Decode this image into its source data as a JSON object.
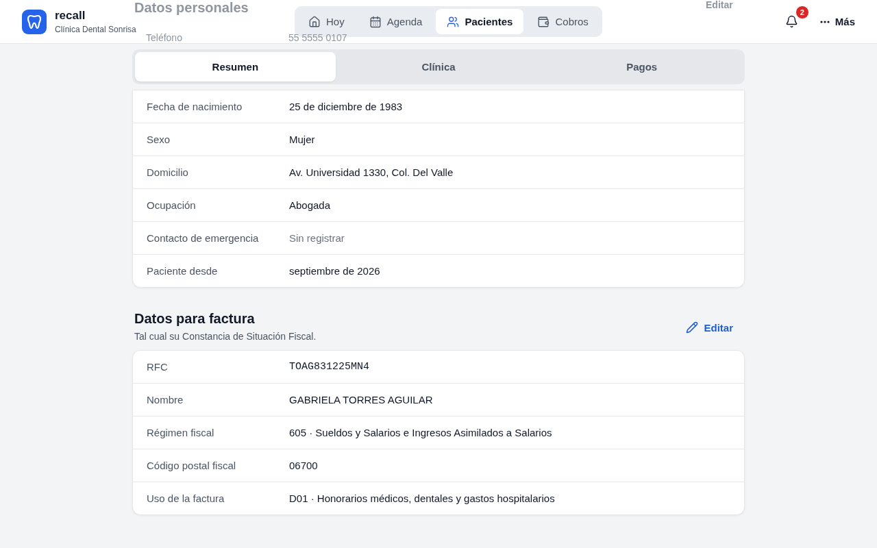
{
  "app": {
    "name": "recall",
    "clinic": "Clínica Dental Sonrisa"
  },
  "nav": [
    {
      "label": "Hoy",
      "selected": false
    },
    {
      "label": "Agenda",
      "selected": false
    },
    {
      "label": "Pacientes",
      "selected": true
    },
    {
      "label": "Cobros",
      "selected": false
    }
  ],
  "notifications": {
    "count": "2"
  },
  "more": {
    "label": "Más"
  },
  "behind_header": {
    "title": "Datos personales",
    "edit": "Editar",
    "label": "Teléfono",
    "value": "55 5555 0107"
  },
  "tabs": [
    {
      "label": "Resumen",
      "selected": true
    },
    {
      "label": "Clínica",
      "selected": false
    },
    {
      "label": "Pagos",
      "selected": false
    }
  ],
  "personal_rows": [
    {
      "label": "Fecha de nacimiento",
      "value": "25 de diciembre de 1983",
      "empty": false
    },
    {
      "label": "Sexo",
      "value": "Mujer",
      "empty": false
    },
    {
      "label": "Domicilio",
      "value": "Av. Universidad 1330, Col. Del Valle",
      "empty": false
    },
    {
      "label": "Ocupación",
      "value": "Abogada",
      "empty": false
    },
    {
      "label": "Contacto de emergencia",
      "value": "Sin registrar",
      "empty": true
    },
    {
      "label": "Paciente desde",
      "value": "septiembre de 2026",
      "empty": false
    }
  ],
  "billing": {
    "title": "Datos para factura",
    "subtitle": "Tal cual su Constancia de Situación Fiscal.",
    "edit": "Editar",
    "rows": [
      {
        "label": "RFC",
        "value": "TOAG831225MN4",
        "kind": "mono"
      },
      {
        "label": "Nombre",
        "value": "GABRIELA TORRES AGUILAR",
        "kind": "text"
      },
      {
        "label": "Régimen fiscal",
        "value": "605 · Sueldos y Salarios e Ingresos Asimilados a Salarios",
        "kind": "text"
      },
      {
        "label": "Código postal fiscal",
        "value": "06700",
        "kind": "text"
      },
      {
        "label": "Uso de la factura",
        "value": "D01 · Honorarios médicos, dentales y gastos hospitalarios",
        "kind": "text"
      }
    ]
  }
}
